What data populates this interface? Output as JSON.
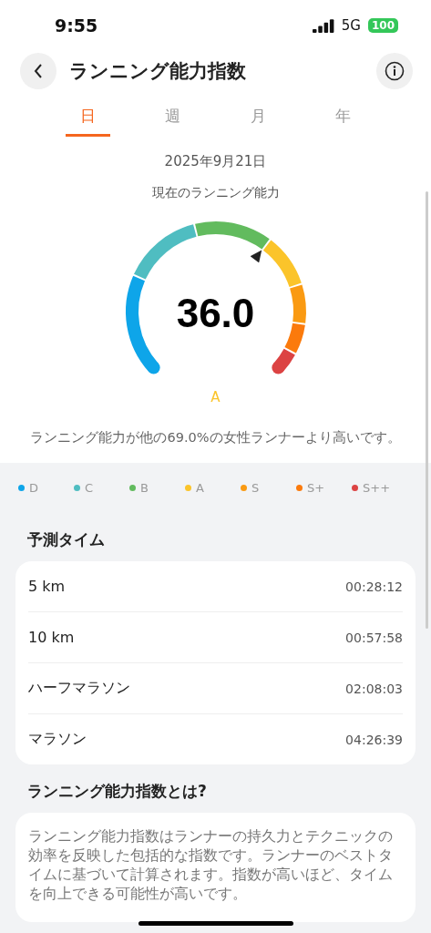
{
  "status_bar": {
    "time": "9:55",
    "network": "5G",
    "battery": "100"
  },
  "header": {
    "title": "ランニング能力指数"
  },
  "tabs": [
    {
      "label": "日",
      "selected": true
    },
    {
      "label": "週",
      "selected": false
    },
    {
      "label": "月",
      "selected": false
    },
    {
      "label": "年",
      "selected": false
    }
  ],
  "date": "2025年9月21日",
  "subtitle": "現在のランニング能力",
  "gauge": {
    "value": "36.0",
    "grade": "A"
  },
  "summary": "ランニング能力が他の69.0%の女性ランナーより高いです。",
  "legend": [
    {
      "label": "D",
      "color": "#0ea5e9"
    },
    {
      "label": "C",
      "color": "#4fbdc1"
    },
    {
      "label": "B",
      "color": "#62bb5e"
    },
    {
      "label": "A",
      "color": "#fbc42a"
    },
    {
      "label": "S",
      "color": "#fa9a12"
    },
    {
      "label": "S+",
      "color": "#fb7a0c"
    },
    {
      "label": "S++",
      "color": "#dc4343"
    }
  ],
  "predicted": {
    "title": "予測タイム",
    "rows": [
      {
        "distance": "5 km",
        "time": "00:28:12"
      },
      {
        "distance": "10 km",
        "time": "00:57:58"
      },
      {
        "distance": "ハーフマラソン",
        "time": "02:08:03"
      },
      {
        "distance": "マラソン",
        "time": "04:26:39"
      }
    ]
  },
  "about": {
    "title": "ランニング能力指数とは?",
    "text": "ランニング能力指数はランナーの持久力とテクニックの効率を反映した包括的な指数です。ランナーのベストタイムに基づいて計算されます。指数が高いほど、タイムを向上できる可能性が高いです。"
  }
}
